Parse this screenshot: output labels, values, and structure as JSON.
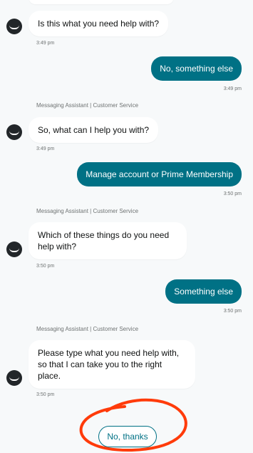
{
  "messages": [
    {
      "type": "incoming",
      "text": "Is this what you need help with?",
      "time": "3:49 pm"
    },
    {
      "type": "outgoing",
      "text": "No, something else",
      "time": "3:49 pm"
    },
    {
      "type": "incoming",
      "sender": "Messaging Assistant | Customer Service",
      "text": "So, what can I help you with?",
      "time": "3:49 pm"
    },
    {
      "type": "outgoing",
      "text": "Manage account or Prime Membership",
      "time": "3:50 pm"
    },
    {
      "type": "incoming",
      "sender": "Messaging Assistant | Customer Service",
      "text": "Which of these things do you need help with?",
      "time": "3:50 pm"
    },
    {
      "type": "outgoing",
      "text": "Something else",
      "time": "3:50 pm"
    },
    {
      "type": "incoming",
      "sender": "Messaging Assistant | Customer Service",
      "text": "Please type what you need help with, so that I can take you to the right place.",
      "time": "3:50 pm"
    }
  ],
  "quick_reply": {
    "label": "No, thanks"
  },
  "colors": {
    "accent": "#007185",
    "annotation": "#ff3b0a",
    "avatar": "#222629"
  }
}
